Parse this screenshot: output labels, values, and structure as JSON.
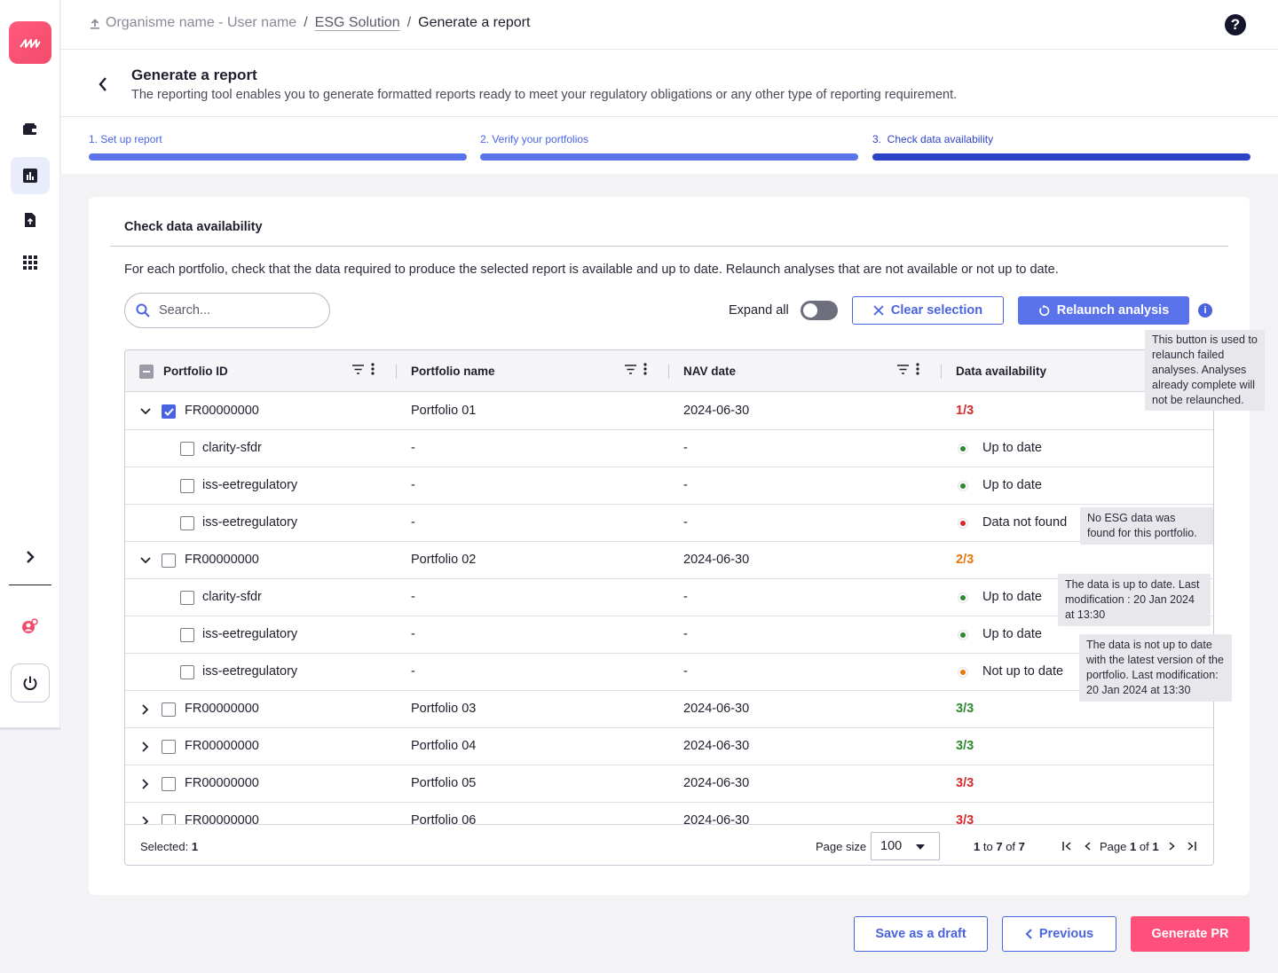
{
  "sidebar": {
    "items": [
      {
        "icon": "wallet-icon"
      },
      {
        "icon": "bar-chart-icon"
      },
      {
        "icon": "file-upload-icon"
      },
      {
        "icon": "apps-grid-icon"
      }
    ],
    "expand_icon": "chevron-right-icon",
    "user_icon": "user-settings-icon",
    "power_icon": "power-icon"
  },
  "header": {
    "org": "Organisme name - User name",
    "solution": "ESG Solution",
    "current": "Generate a report",
    "sep": "/"
  },
  "page": {
    "title": "Generate a report",
    "subtitle": "The reporting tool enables you to generate formatted reports ready to meet your regulatory obligations or any other type of reporting requirement."
  },
  "steps": [
    {
      "label": "1. Set up report"
    },
    {
      "label": "2. Verify your portfolios"
    },
    {
      "label": "3.  Check data availability"
    }
  ],
  "card": {
    "title": "Check data availability",
    "description": "For each portfolio, check that the data required to produce the selected report is available and up to date. Relaunch analyses that are not available or not up to date."
  },
  "toolbar": {
    "search_placeholder": "Search...",
    "expand_all": "Expand all",
    "clear_selection": "Clear selection",
    "relaunch": "Relaunch analysis",
    "relaunch_tooltip": "This button is used to relaunch failed analyses. Analyses already complete will not be relaunched."
  },
  "table": {
    "columns": [
      "Portfolio ID",
      "Portfolio name",
      "NAV date",
      "Data availability"
    ],
    "rows": [
      {
        "id": "FR00000000",
        "name": "Portfolio 01",
        "date": "2024-06-30",
        "avail": "1/3",
        "level": "parent"
      },
      {
        "id": "clarity-sfdr",
        "name": "-",
        "date": "-",
        "avail": "Up to date",
        "level": "child"
      },
      {
        "id": "iss-eetregulatory",
        "name": "-",
        "date": "-",
        "avail": "Up to date",
        "level": "child"
      },
      {
        "id": "iss-eetregulatory",
        "name": "-",
        "date": "-",
        "avail": "Data not found",
        "level": "child"
      },
      {
        "id": "FR00000000",
        "name": "Portfolio 02",
        "date": "2024-06-30",
        "avail": "2/3",
        "level": "parent"
      },
      {
        "id": "clarity-sfdr",
        "name": "-",
        "date": "-",
        "avail": "Up to date",
        "level": "child"
      },
      {
        "id": "iss-eetregulatory",
        "name": "-",
        "date": "-",
        "avail": "Up to date",
        "level": "child"
      },
      {
        "id": "iss-eetregulatory",
        "name": "-",
        "date": "-",
        "avail": "Not up to date",
        "level": "child"
      },
      {
        "id": "FR00000000",
        "name": "Portfolio 03",
        "date": "2024-06-30",
        "avail": "3/3",
        "level": "parent"
      },
      {
        "id": "FR00000000",
        "name": "Portfolio 04",
        "date": "2024-06-30",
        "avail": "3/3",
        "level": "parent"
      },
      {
        "id": "FR00000000",
        "name": "Portfolio 05",
        "date": "2024-06-30",
        "avail": "3/3",
        "level": "parent"
      },
      {
        "id": "FR00000000",
        "name": "Portfolio 06",
        "date": "2024-06-30",
        "avail": "3/3",
        "level": "parent"
      }
    ],
    "tooltips": {
      "not_found": "No ESG data was found for this portfolio.",
      "up_to_date": "The data is up to date. Last modification : 20 Jan 2024 at 13:30",
      "not_up_to_date": "The data is not up to date with the latest version of the portfolio. Last modification: 20 Jan 2024 at 13:30"
    },
    "footer": {
      "selected_label": "Selected:",
      "selected_count": "1",
      "page_size_label": "Page size",
      "page_size": "100",
      "range_from": "1",
      "range_to_word": "to",
      "range_to": "7",
      "range_of_word": "of",
      "range_total": "7",
      "page_word": "Page",
      "page_current": "1",
      "page_of_word": "of",
      "page_total": "1"
    }
  },
  "actions": {
    "save_draft": "Save as a draft",
    "previous": "Previous",
    "generate": "Generate PR"
  },
  "colors": {
    "accent": "#5b73ea",
    "pink": "#ff4f7b",
    "status_green": "#2e8a2e",
    "status_red": "#d42a2a",
    "status_orange": "#e6760e"
  }
}
